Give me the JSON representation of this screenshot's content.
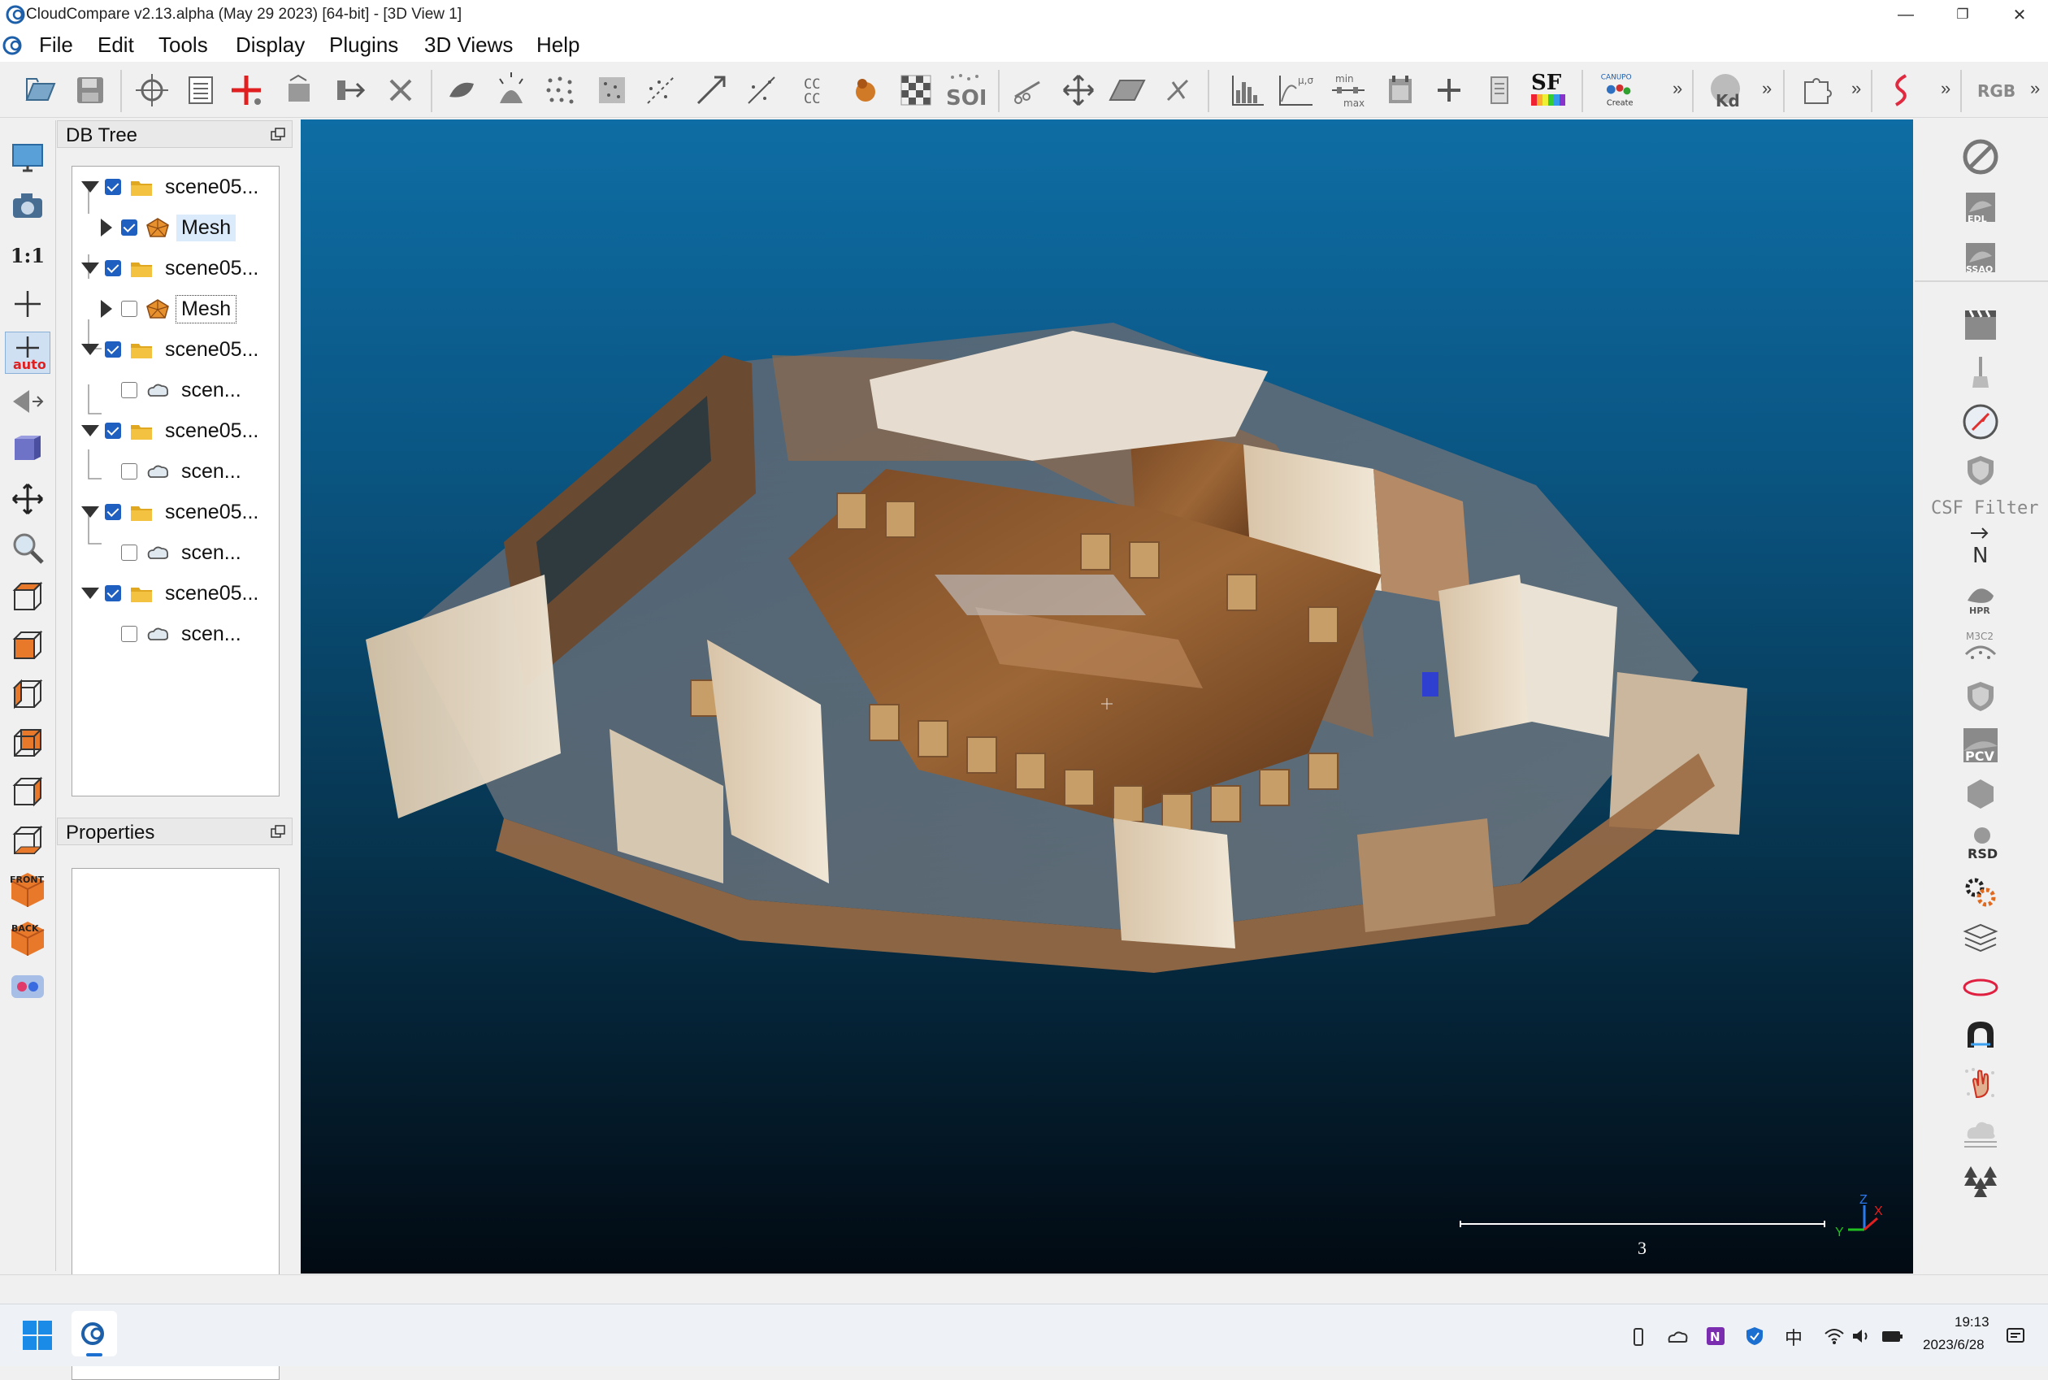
{
  "window": {
    "title": "CloudCompare v2.13.alpha (May 29 2023) [64-bit] - [3D View 1]",
    "controls": {
      "minimize": "—",
      "maximize": "❐",
      "close": "✕"
    }
  },
  "menu": [
    "File",
    "Edit",
    "Tools",
    "Display",
    "Plugins",
    "3D Views",
    "Help"
  ],
  "toolbar": {
    "sor_label": "SOR",
    "sf_label": "SF",
    "canupo_label": "CANUPO",
    "canupo_sub": "Create",
    "kd_label": "Kd",
    "ccc_label": "CC",
    "minmax_top": "min",
    "minmax_bottom": "max",
    "mu_sigma": "μ,σ",
    "rgb_label": "RGB",
    "overflow": "»"
  },
  "left_toolbar": {
    "one_to_one": "1:1",
    "auto_label": "auto",
    "front_label": "FRONT",
    "back_label": "BACK"
  },
  "db_tree": {
    "title": "DB Tree",
    "items": [
      {
        "label": "scene05...",
        "checked": true,
        "expanded": true,
        "type": "folder",
        "level": 0
      },
      {
        "label": "Mesh",
        "checked": true,
        "expanded": false,
        "type": "mesh",
        "level": 1,
        "selected": true
      },
      {
        "label": "scene05...",
        "checked": true,
        "expanded": true,
        "type": "folder",
        "level": 0
      },
      {
        "label": "Mesh",
        "checked": false,
        "expanded": false,
        "type": "mesh",
        "level": 1,
        "focused": true
      },
      {
        "label": "scene05...",
        "checked": true,
        "expanded": true,
        "type": "folder",
        "level": 0
      },
      {
        "label": "scen...",
        "checked": false,
        "type": "cloud",
        "level": 1
      },
      {
        "label": "scene05...",
        "checked": true,
        "expanded": true,
        "type": "folder",
        "level": 0
      },
      {
        "label": "scen...",
        "checked": false,
        "type": "cloud",
        "level": 1
      },
      {
        "label": "scene05...",
        "checked": true,
        "expanded": true,
        "type": "folder",
        "level": 0
      },
      {
        "label": "scen...",
        "checked": false,
        "type": "cloud",
        "level": 1
      },
      {
        "label": "scene05...",
        "checked": true,
        "expanded": true,
        "type": "folder",
        "level": 0
      },
      {
        "label": "scen...",
        "checked": false,
        "type": "cloud",
        "level": 1
      }
    ]
  },
  "properties": {
    "title": "Properties"
  },
  "view3d": {
    "scale_value": "3",
    "axes": {
      "x": "X",
      "y": "Y",
      "z": "Z"
    }
  },
  "right_toolbar": {
    "edl": "EDL",
    "ssao": "SSAO",
    "csf_filter": "CSF Filter",
    "north": "N",
    "hpr": "HPR",
    "m3c2": "M3C2",
    "pcv": "PCV",
    "rsd": "RSD"
  },
  "taskbar": {
    "time": "19:13",
    "date": "2023/6/28",
    "ime": "中"
  },
  "colors": {
    "view_top": "#0e6da4",
    "view_bottom": "#020a12",
    "checkbox_on": "#1e5fbf",
    "selection": "#dcebfb"
  }
}
